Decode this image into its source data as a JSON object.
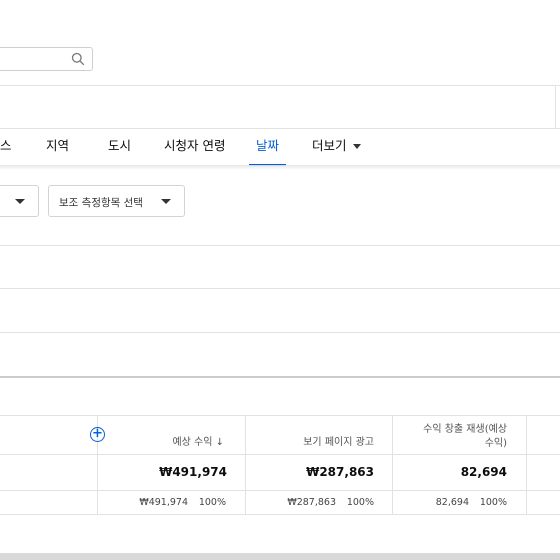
{
  "search": {
    "value": "",
    "icon": "search-icon"
  },
  "tabs": [
    {
      "label": "스"
    },
    {
      "label": "지역"
    },
    {
      "label": "도시"
    },
    {
      "label": "시청자 연령"
    },
    {
      "label": "날짜",
      "active": true
    },
    {
      "label": "더보기"
    }
  ],
  "filters": {
    "primary": {
      "label": ""
    },
    "secondary": {
      "label": "보조 측정항목 선택"
    }
  },
  "table": {
    "columns": [
      {
        "label": "예상 수익 ↓"
      },
      {
        "label": "보기 페이지 광고"
      },
      {
        "label_line1": "수익 창출 재생(예상",
        "label_line2": "수익)"
      }
    ],
    "totals": [
      "₩491,974",
      "₩287,863",
      "82,694"
    ],
    "row": [
      {
        "value": "₩491,974",
        "percent": "100%"
      },
      {
        "value": "₩287,863",
        "percent": "100%"
      },
      {
        "value": "82,694",
        "percent": "100%"
      }
    ]
  },
  "colors": {
    "accent": "#065fd4",
    "border": "#e2e2e2"
  }
}
